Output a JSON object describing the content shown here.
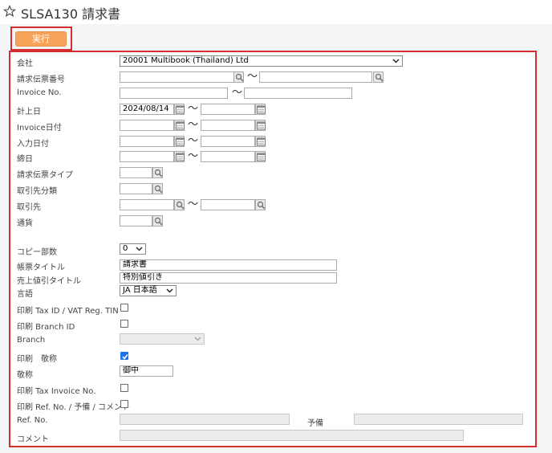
{
  "header": {
    "title": "SLSA130 請求書",
    "star_icon": "star-outline-icon"
  },
  "toolbar": {
    "execute_label": "実行"
  },
  "form": {
    "company": {
      "label": "会社",
      "value": "20001 Multibook (Thailand) Ltd"
    },
    "invoice_slip_no": {
      "label": "請求伝票番号",
      "from": "",
      "to": ""
    },
    "invoice_no": {
      "label": "Invoice No.",
      "from": "",
      "to": ""
    },
    "posting_date": {
      "label": "計上日",
      "from": "2024/08/14",
      "to": ""
    },
    "invoice_date": {
      "label": "Invoice日付",
      "from": "",
      "to": ""
    },
    "input_date": {
      "label": "入力日付",
      "from": "",
      "to": ""
    },
    "closing_date": {
      "label": "締日",
      "from": "",
      "to": ""
    },
    "invoice_slip_type": {
      "label": "請求伝票タイプ",
      "value": ""
    },
    "partner_category": {
      "label": "取引先分類",
      "value": ""
    },
    "partner": {
      "label": "取引先",
      "from": "",
      "to": ""
    },
    "currency": {
      "label": "通貨",
      "value": ""
    },
    "copies": {
      "label": "コピー部数",
      "value": "0"
    },
    "form_title": {
      "label": "帳票タイトル",
      "value": "請求書"
    },
    "discount_title": {
      "label": "売上値引タイトル",
      "value": "特別値引き"
    },
    "language": {
      "label": "言語",
      "value": "JA 日本語"
    },
    "print_tax_id": {
      "label": "印刷 Tax ID / VAT Reg. TIN",
      "checked": false
    },
    "print_branch_id": {
      "label": "印刷 Branch ID",
      "checked": false
    },
    "branch": {
      "label": "Branch",
      "value": ""
    },
    "print_honorific": {
      "label": "印刷　敬称",
      "checked": true
    },
    "honorific": {
      "label": "敬称",
      "value": "御中"
    },
    "print_tax_invoice_no": {
      "label": "印刷 Tax Invoice No.",
      "checked": false
    },
    "print_ref_no": {
      "label": "印刷 Ref. No. / 予備 / コメント",
      "checked": false
    },
    "ref_no": {
      "label": "Ref. No.",
      "value": ""
    },
    "reserve": {
      "label": "予備",
      "value": ""
    },
    "comment": {
      "label": "コメント",
      "value": ""
    },
    "range_separator": "〜"
  }
}
